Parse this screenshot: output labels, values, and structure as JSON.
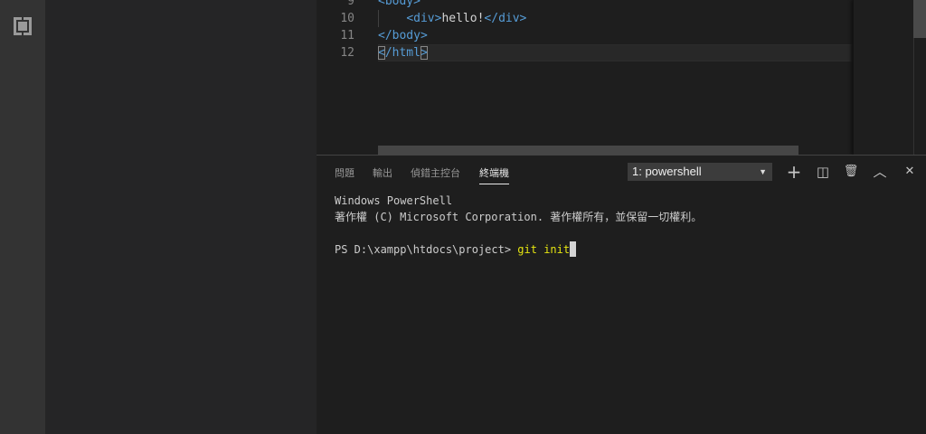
{
  "editor": {
    "lines": [
      {
        "num": "9",
        "open": "<body>"
      },
      {
        "num": "10",
        "open": "<div>",
        "text": "hello!",
        "close": "</div>"
      },
      {
        "num": "11",
        "close": "</body>"
      },
      {
        "num": "12",
        "lt": "<",
        "name": "/html",
        "gt": ">"
      }
    ]
  },
  "panel": {
    "tabs": [
      "問題",
      "輸出",
      "偵錯主控台",
      "終端機"
    ],
    "terminal_select": "1: powershell",
    "actions": {
      "new": "+",
      "split": "◫",
      "kill": "🗑",
      "maximize": "︿",
      "close": "✕"
    }
  },
  "terminal": {
    "line1": "Windows PowerShell",
    "line2": "著作權 (C) Microsoft Corporation. 著作權所有，並保留一切權利。",
    "prompt": "PS D:\\xampp\\htdocs\\project> ",
    "command": "git init"
  }
}
